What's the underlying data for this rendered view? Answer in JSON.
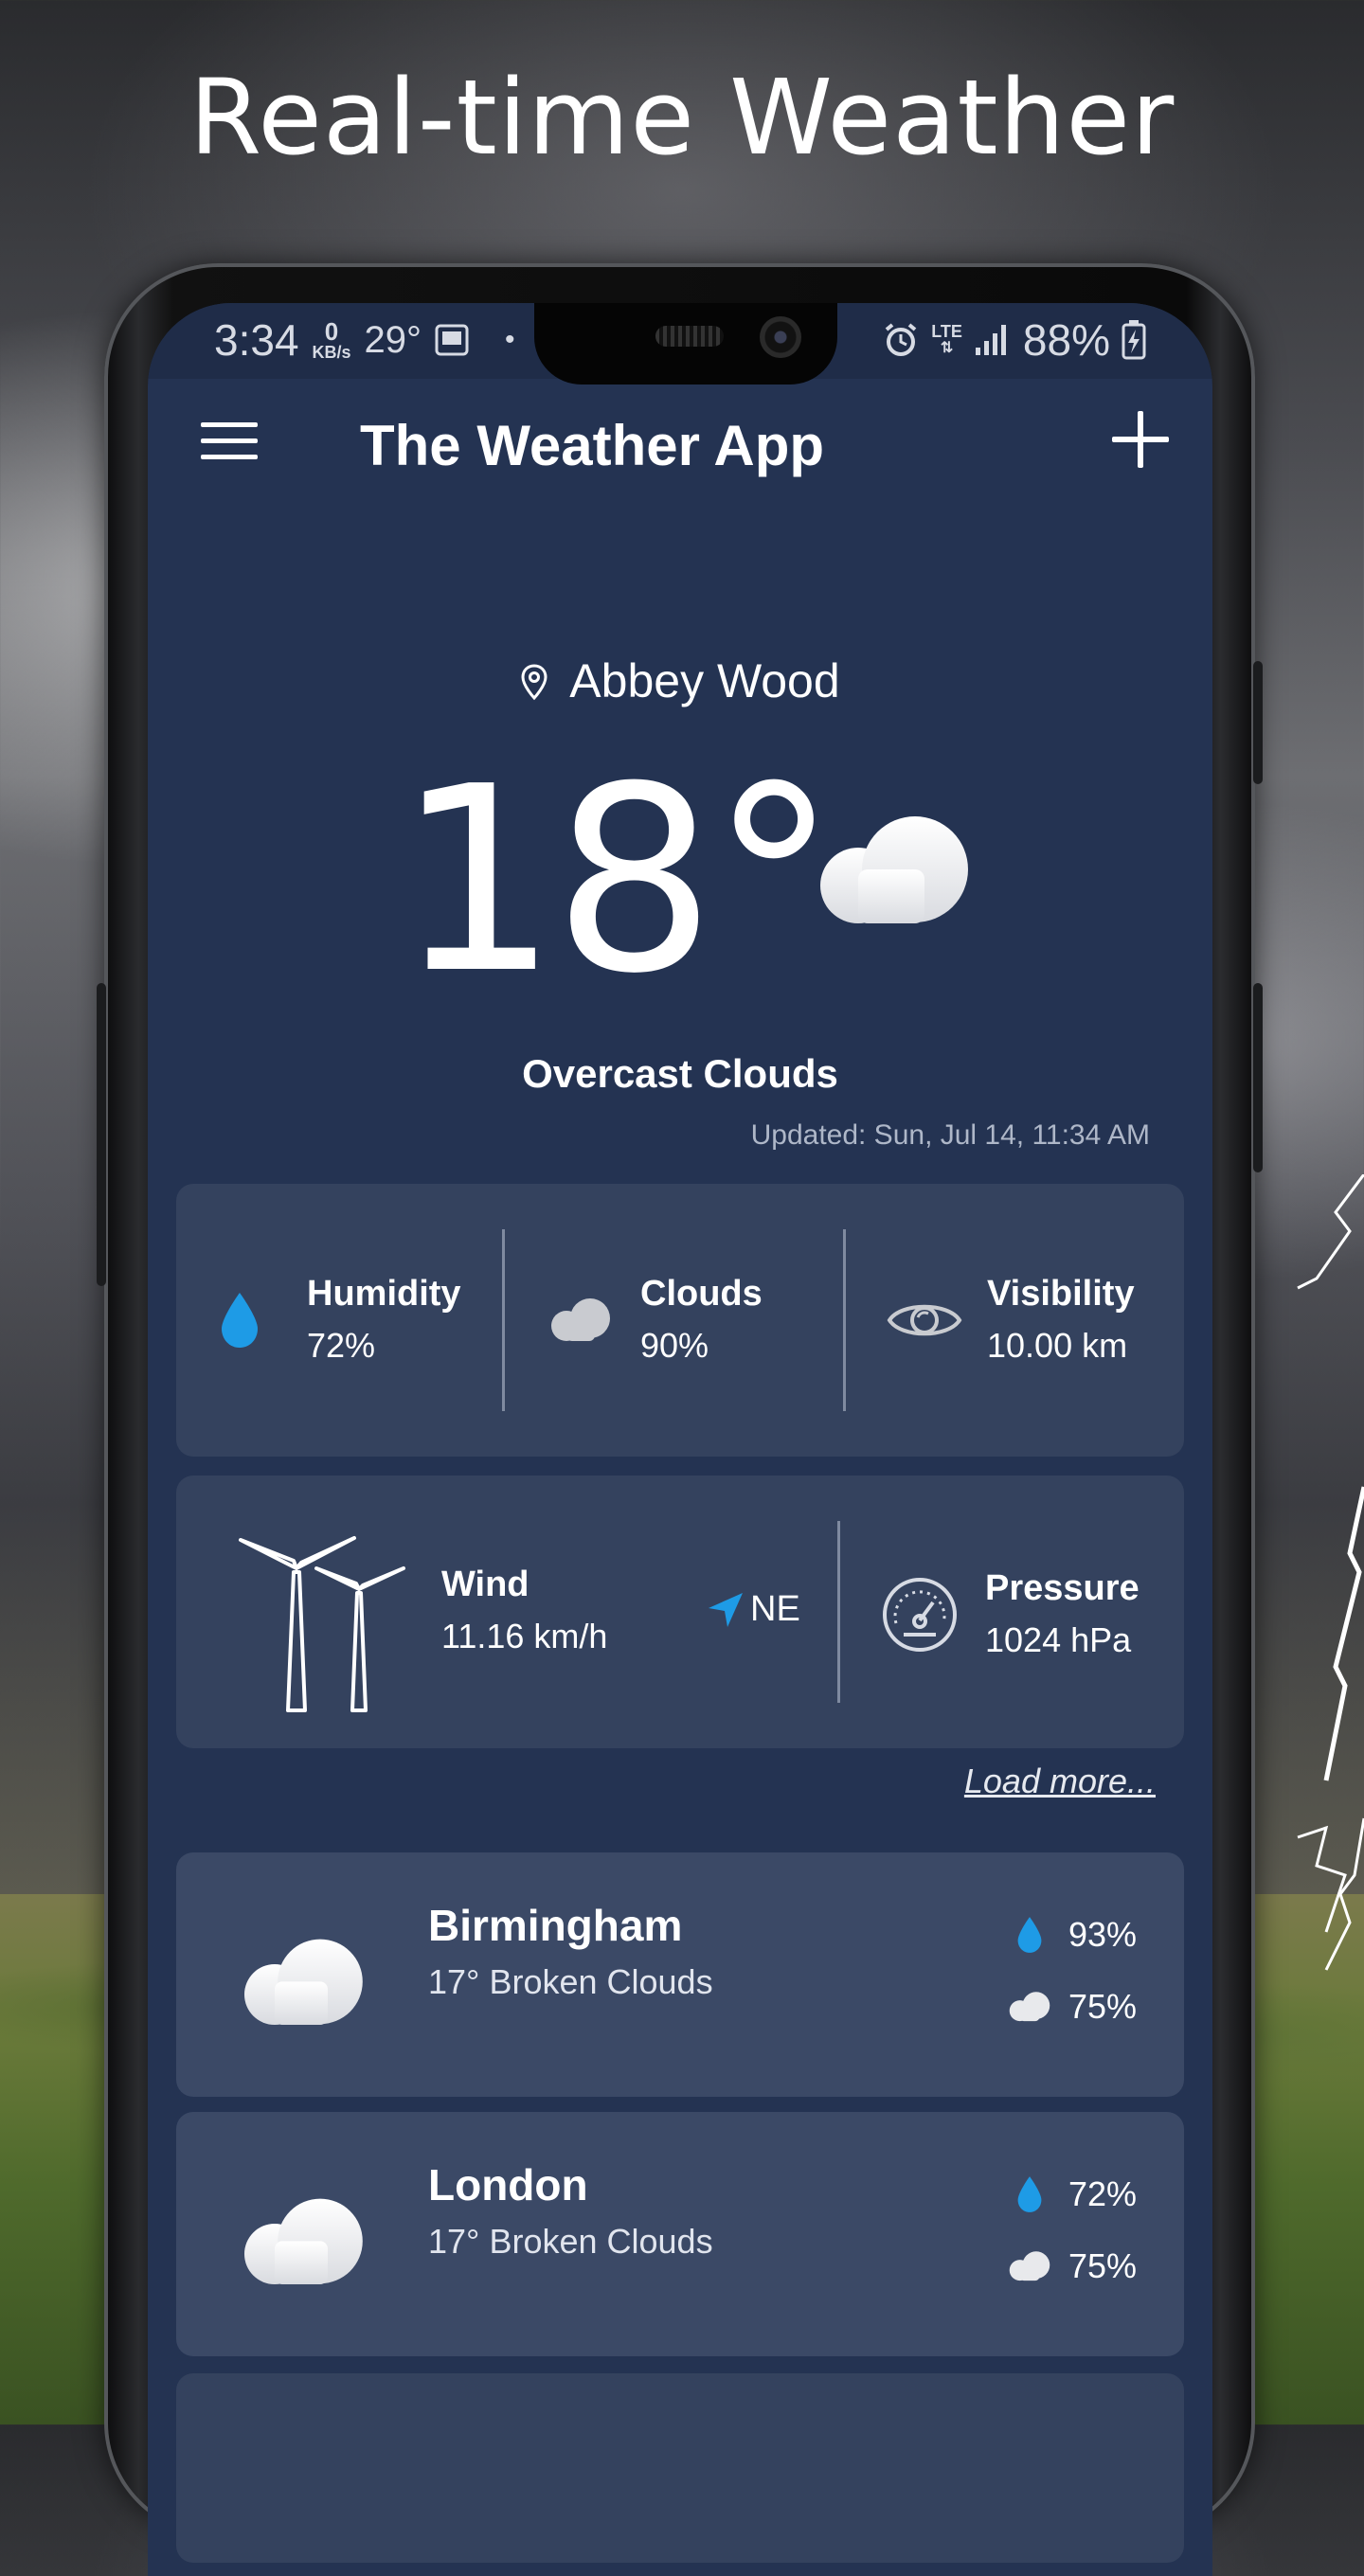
{
  "promo": {
    "headline": "Real-time Weather"
  },
  "status_bar": {
    "time": "3:34",
    "data_rate_value": "0",
    "data_rate_unit": "KB/s",
    "temp": "29°",
    "network": "LTE",
    "battery": "88%"
  },
  "app_bar": {
    "title": "The Weather App"
  },
  "current": {
    "location": "Abbey Wood",
    "temperature": "18°",
    "condition": "Overcast Clouds",
    "updated": "Updated: Sun, Jul 14, 11:34 AM"
  },
  "details": {
    "humidity": {
      "label": "Humidity",
      "value": "72%"
    },
    "clouds": {
      "label": "Clouds",
      "value": "90%"
    },
    "visibility": {
      "label": "Visibility",
      "value": "10.00 km"
    },
    "wind": {
      "label": "Wind",
      "value": "11.16 km/h",
      "direction": "NE"
    },
    "pressure": {
      "label": "Pressure",
      "value": "1024 hPa"
    }
  },
  "load_more": "Load more...",
  "cities": [
    {
      "name": "Birmingham",
      "description": "17° Broken Clouds",
      "humidity": "93%",
      "clouds": "75%"
    },
    {
      "name": "London",
      "description": "17° Broken Clouds",
      "humidity": "72%",
      "clouds": "75%"
    }
  ],
  "colors": {
    "screen_bg": "#243352",
    "card_bg": "#34425e",
    "city_card_bg": "#3b4966",
    "accent_blue": "#1e9be6"
  },
  "icons": [
    "menu-icon",
    "add-icon",
    "location-pin-icon",
    "cloud-icon",
    "water-drop-icon",
    "eye-icon",
    "wind-turbine-icon",
    "navigation-arrow-icon",
    "gauge-icon"
  ]
}
